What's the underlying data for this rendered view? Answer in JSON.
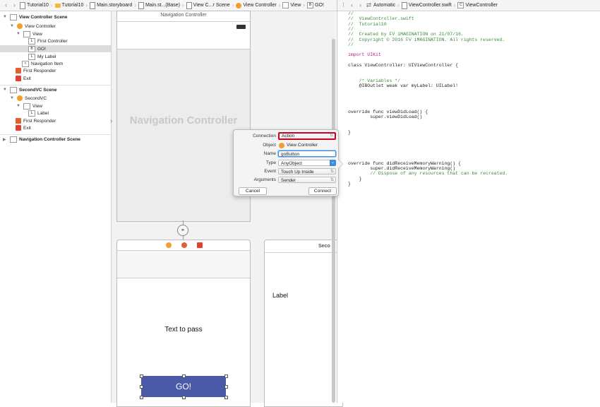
{
  "left_jumpbar": {
    "crumbs": [
      "Tutorial10",
      "Tutorial10",
      "Main.storyboard",
      "Main.st...(Base)",
      "View C...r Scene",
      "View Controller",
      "View",
      "GO!"
    ]
  },
  "right_jumpbar": {
    "crumbs": [
      "Automatic",
      "ViewController.swift",
      "ViewController"
    ]
  },
  "outline": {
    "scene1": "View Controller Scene",
    "vc": "View Controller",
    "view": "View",
    "first_controller": "First Controller",
    "go": "GO!",
    "my_label": "My Label",
    "nav_item": "Navigation Item",
    "first_responder": "First Responder",
    "exit": "Exit",
    "scene2": "SecondVC Scene",
    "secondvc": "SecondVC",
    "view2": "View",
    "label": "Label",
    "first_responder2": "First Responder",
    "exit2": "Exit",
    "scene3": "Navigation Controller Scene"
  },
  "canvas": {
    "nav_title": "Navigation Controller",
    "nav_placeholder": "Navigation Controller",
    "text_to_pass": "Text to pass",
    "go_button": "GO!",
    "label": "Label",
    "second_title": "Seco"
  },
  "code": {
    "lines": [
      {
        "t": "//",
        "c": "cm"
      },
      {
        "t": "//  ViewController.swift",
        "c": "cm"
      },
      {
        "t": "//  Tutorial10",
        "c": "cm"
      },
      {
        "t": "//",
        "c": "cm"
      },
      {
        "t": "//  Created by FV iMAGINATION on 21/07/16.",
        "c": "cm"
      },
      {
        "t": "//  Copyright © 2016 FV iMAGINATION. All rights reserved.",
        "c": "cm"
      },
      {
        "t": "//",
        "c": "cm"
      },
      {
        "t": "",
        "c": "pl"
      },
      {
        "t": "import UIKit",
        "c": "kw"
      },
      {
        "t": "",
        "c": "pl"
      },
      {
        "t": "class ViewController: UIViewController {",
        "c": "pl"
      },
      {
        "t": "",
        "c": "pl"
      },
      {
        "t": "",
        "c": "pl"
      },
      {
        "t": "    /* Variables */",
        "c": "cm"
      },
      {
        "t": "    @IBOutlet weak var myLabel: UILabel!",
        "c": "pl"
      },
      {
        "t": "",
        "c": "pl"
      },
      {
        "t": "",
        "c": "pl"
      },
      {
        "t": "",
        "c": "pl"
      },
      {
        "t": "",
        "c": "pl"
      },
      {
        "t": "override func viewDidLoad() {",
        "c": "pl"
      },
      {
        "t": "        super.viewDidLoad()",
        "c": "pl"
      },
      {
        "t": "",
        "c": "pl"
      },
      {
        "t": "",
        "c": "pl"
      },
      {
        "t": "}",
        "c": "pl"
      },
      {
        "t": "",
        "c": "pl"
      },
      {
        "t": "",
        "c": "pl"
      },
      {
        "t": "",
        "c": "pl"
      },
      {
        "t": "",
        "c": "pl"
      },
      {
        "t": "",
        "c": "pl"
      },
      {
        "t": "override func didReceiveMemoryWarning() {",
        "c": "pl"
      },
      {
        "t": "        super.didReceiveMemoryWarning()",
        "c": "pl"
      },
      {
        "t": "        // Dispose of any resources that can be recreated.",
        "c": "cm"
      },
      {
        "t": "    }",
        "c": "pl"
      },
      {
        "t": "}",
        "c": "pl"
      }
    ]
  },
  "popover": {
    "connection_label": "Connection",
    "connection_value": "Action",
    "object_label": "Object",
    "object_value": "View Controller",
    "name_label": "Name",
    "name_value": "goButton",
    "type_label": "Type",
    "type_value": "AnyObject",
    "event_label": "Event",
    "event_value": "Touch Up Inside",
    "arguments_label": "Arguments",
    "arguments_value": "Sender",
    "cancel": "Cancel",
    "connect": "Connect"
  },
  "colors": {
    "go_button_bg": "#4a5aa8",
    "highlight_border": "#d0021b",
    "selection_blue": "#3b8de0"
  }
}
